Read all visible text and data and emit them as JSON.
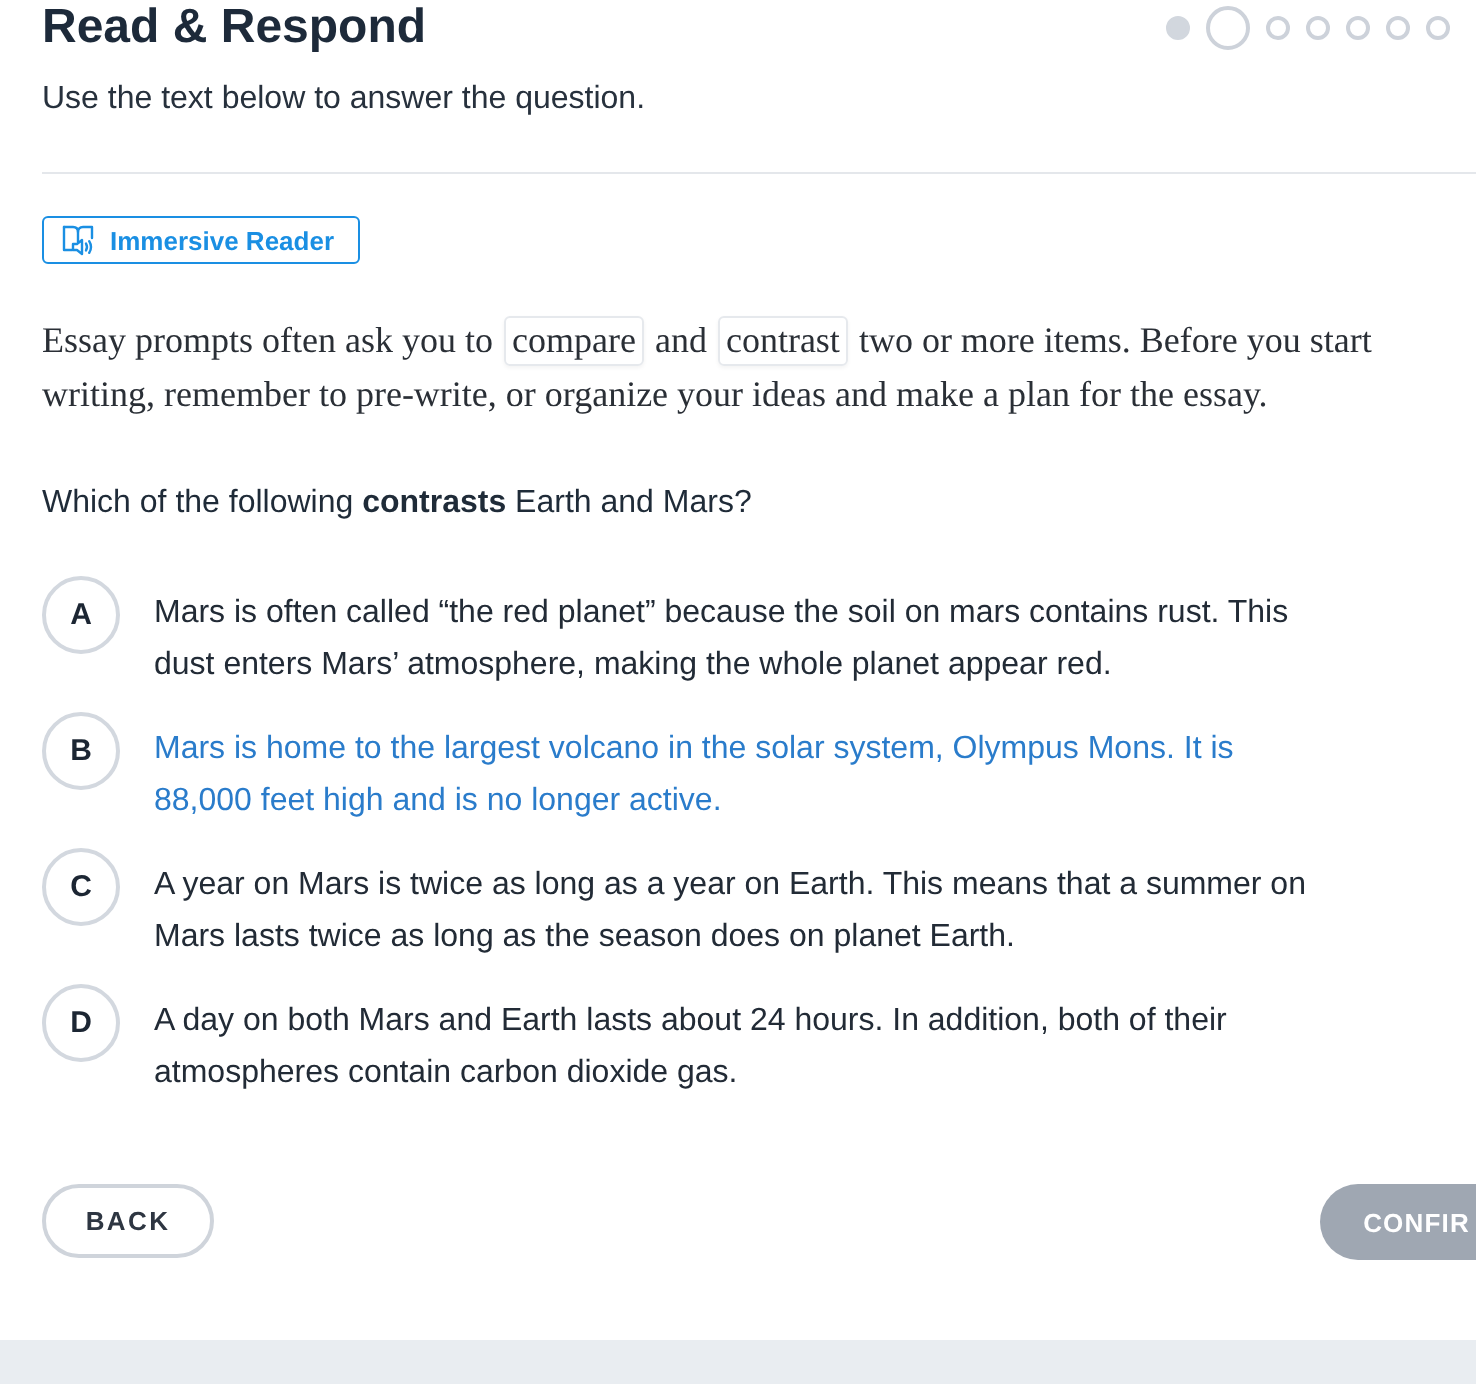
{
  "header": {
    "title": "Read & Respond",
    "progress": [
      {
        "completed": true,
        "current": false
      },
      {
        "completed": false,
        "current": true
      },
      {
        "completed": false,
        "current": false
      },
      {
        "completed": false,
        "current": false
      },
      {
        "completed": false,
        "current": false
      },
      {
        "completed": false,
        "current": false
      },
      {
        "completed": false,
        "current": false
      }
    ]
  },
  "instructions": "Use the text below to answer the question.",
  "immersive_reader": {
    "label": "Immersive Reader"
  },
  "passage": [
    {
      "kind": "plain",
      "text": "Essay prompts often ask you to "
    },
    {
      "kind": "term",
      "text": "compare"
    },
    {
      "kind": "plain",
      "text": " and "
    },
    {
      "kind": "term",
      "text": "contrast"
    },
    {
      "kind": "plain",
      "text": " two or more items. Before you start writing, remember to pre-write, or organize your ideas and make a plan for the essay."
    }
  ],
  "question": "Which of the following **contrasts** Earth and Mars?",
  "options": [
    {
      "letter": "A",
      "text": "Mars is often called “the red planet” because the soil on mars contains rust. This dust enters Mars’ atmosphere, making the whole planet appear red.",
      "hovered": false
    },
    {
      "letter": "B",
      "text": "Mars is home to the largest volcano in the solar system, Olympus Mons. It is 88,000 feet high and is no longer active.",
      "hovered": true
    },
    {
      "letter": "C",
      "text": "A year on Mars is twice as long as a year on Earth. This means that a summer on Mars lasts twice as long as the season does on planet Earth.",
      "hovered": false
    },
    {
      "letter": "D",
      "text": "A day on both Mars and Earth lasts about 24 hours. In addition, both of their atmospheres contain carbon dioxide gas.",
      "hovered": false
    }
  ],
  "buttons": {
    "back": {
      "label": "BACK"
    },
    "confirm": {
      "label": "CONFIR",
      "disabled": true
    }
  }
}
